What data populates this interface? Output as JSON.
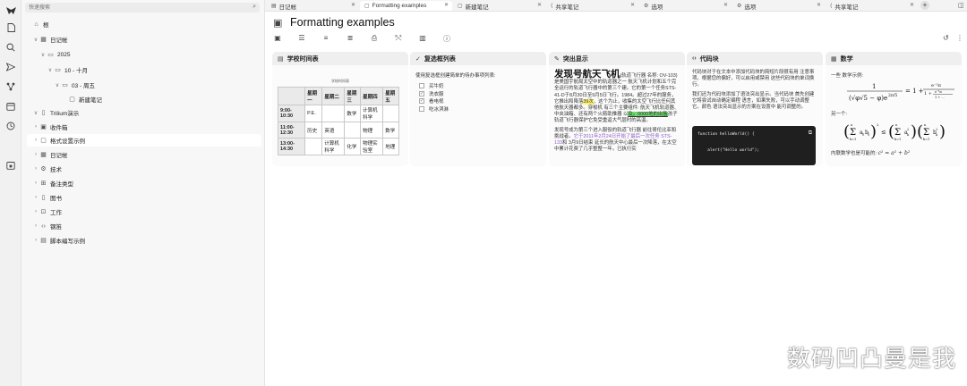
{
  "colors": {
    "accent": "#222222",
    "sidebar_bg": "#f7f7f7",
    "code_bg": "#1f1f1f",
    "highlight_yellow": "#fff36b",
    "highlight_green": "#6fd86f",
    "link_purple": "#8a5cc8"
  },
  "launcher": {
    "icons": [
      "trilium-logo-icon",
      "new-note-icon",
      "search-icon",
      "send-icon",
      "relation-map-icon",
      "calendar-icon",
      "history-icon",
      "today-icon"
    ]
  },
  "sidebar": {
    "search_placeholder": "快速搜索",
    "tree": [
      {
        "label": "根",
        "level": 0,
        "icon": "house-icon",
        "chev": ""
      },
      {
        "label": "日记帐",
        "level": 1,
        "icon": "calendar-icon",
        "chev": "∨"
      },
      {
        "label": "2025",
        "level": 2,
        "icon": "folder-icon",
        "chev": "∨"
      },
      {
        "label": "10 - 十月",
        "level": 3,
        "icon": "folder-icon",
        "chev": "∨"
      },
      {
        "label": "03 - 周五",
        "level": 4,
        "icon": "folder-icon",
        "chev": "∨"
      },
      {
        "label": "新建笔记",
        "level": 5,
        "icon": "note-icon",
        "chev": ""
      },
      {
        "label": "Trilium演示",
        "level": 1,
        "icon": "book-icon",
        "chev": "∨"
      },
      {
        "label": "收件箱",
        "level": 2,
        "icon": "inbox-icon",
        "chev": "›"
      },
      {
        "label": "格式设置示例",
        "level": 2,
        "icon": "note-icon",
        "chev": "›",
        "active": true
      },
      {
        "label": "日记帐",
        "level": 2,
        "icon": "calendar-icon",
        "chev": "›"
      },
      {
        "label": "技术",
        "level": 2,
        "icon": "gear-icon",
        "chev": "›"
      },
      {
        "label": "备注类型",
        "level": 2,
        "icon": "grid-icon",
        "chev": "›"
      },
      {
        "label": "图书",
        "level": 2,
        "icon": "book-icon",
        "chev": "›"
      },
      {
        "label": "工作",
        "level": 2,
        "icon": "briefcase-icon",
        "chev": "›"
      },
      {
        "label": "钢笛",
        "level": 2,
        "icon": "code-icon",
        "chev": "›"
      },
      {
        "label": "脚本编写示例",
        "level": 2,
        "icon": "script-icon",
        "chev": "›"
      }
    ]
  },
  "tabs": [
    {
      "label": "日记帐",
      "icon": "▤",
      "active": false
    },
    {
      "label": "Formatting examples",
      "icon": "▢",
      "active": true
    },
    {
      "label": "新建笔记",
      "icon": "▢",
      "active": false
    },
    {
      "label": "共享笔记",
      "icon": "⟨",
      "active": false
    },
    {
      "label": "选项",
      "icon": "⚙",
      "active": false
    },
    {
      "label": "选项",
      "icon": "⚙",
      "active": false
    },
    {
      "label": "共享笔记",
      "icon": "⟨",
      "active": false
    }
  ],
  "note": {
    "title": "Formatting examples"
  },
  "cards": {
    "timetable": {
      "title": "学校时间表",
      "caption": "学校时间表",
      "headers": [
        "",
        "星期一",
        "星期二",
        "星期三",
        "星期四",
        "星期五"
      ],
      "rows": [
        [
          "9:00-10:30",
          "P.E.",
          "",
          "数学",
          "计算机科学",
          ""
        ],
        [
          "11:00-12:30",
          "历史",
          "英语",
          "",
          "物理",
          "数学"
        ],
        [
          "13:00-14:30",
          "",
          "计算机科学",
          "化学",
          "物理实验室",
          "地理"
        ]
      ]
    },
    "checklist": {
      "title": "复选框列表",
      "intro": "使用复选框创建简单的待办事项列表:",
      "items": [
        {
          "label": "买牛奶",
          "checked": false
        },
        {
          "label": "洗衣服",
          "checked": true
        },
        {
          "label": "看电视",
          "checked": true
        },
        {
          "label": "吃冰淇淋",
          "checked": false
        }
      ]
    },
    "highlights": {
      "title": "突出显示",
      "heading": "发现号航天飞机",
      "p1a": "(轨道飞行器 名称: OV-103) 是美国宇航局太空中的轨道器之一 航天飞机计划和五个完全运行的轨道飞行器中的第三个建。它的第一个任务STS-41-D于8月30日至9月5日飞行。1984。超过27年的服务，它推出和降落",
      "p1mark": "39次",
      "p1b": "，这个为止，收集的太空飞行比任何其他航天器都多。穿梭机 有三个主要组件: 航天飞机轨道器、中央油箱、还有两个火箭助推器 以",
      "p1green": "及。0000地的出售",
      "p1c": "孩子 轨道飞行器保护它免受重返大气层时的高温。",
      "p2a": "发现号成为第三个进入服役的轨道飞行器 前往哥伦比亚和挑战者。",
      "p2link": "它于2011年2月24日开始了最后一次任务 STS-133",
      "p2b": "和 3月9日结束 延长的航天中心最后一次降落，在太空中累计花费了几乎整整一年。已执行实"
    },
    "code": {
      "title": "代码块",
      "p1": "代码块对于在文本中添加代码块的简短片段很有用 注意事项。根据您的偏好，可以启用或禁用 这些代码块的单词换行。",
      "p2": "我们还为代码块添加了语法突出显示。当代码块 首先创建它将尝试自动确定编程 语言，如果失败，可以手动调整它。颜色 语法突出显示的方案在设置中 能可调整的。",
      "lines": [
        "function helloWorld() {",
        "",
        "    alert(\"Hello world\");"
      ]
    },
    "math": {
      "title": "数学",
      "intro": "一些 数学示例:",
      "mid": "另一个:",
      "inline_label": "内联数学也是可能的:",
      "inline_formula": "c² = a² + b²"
    }
  },
  "watermark": "数码凹凸曼是我"
}
